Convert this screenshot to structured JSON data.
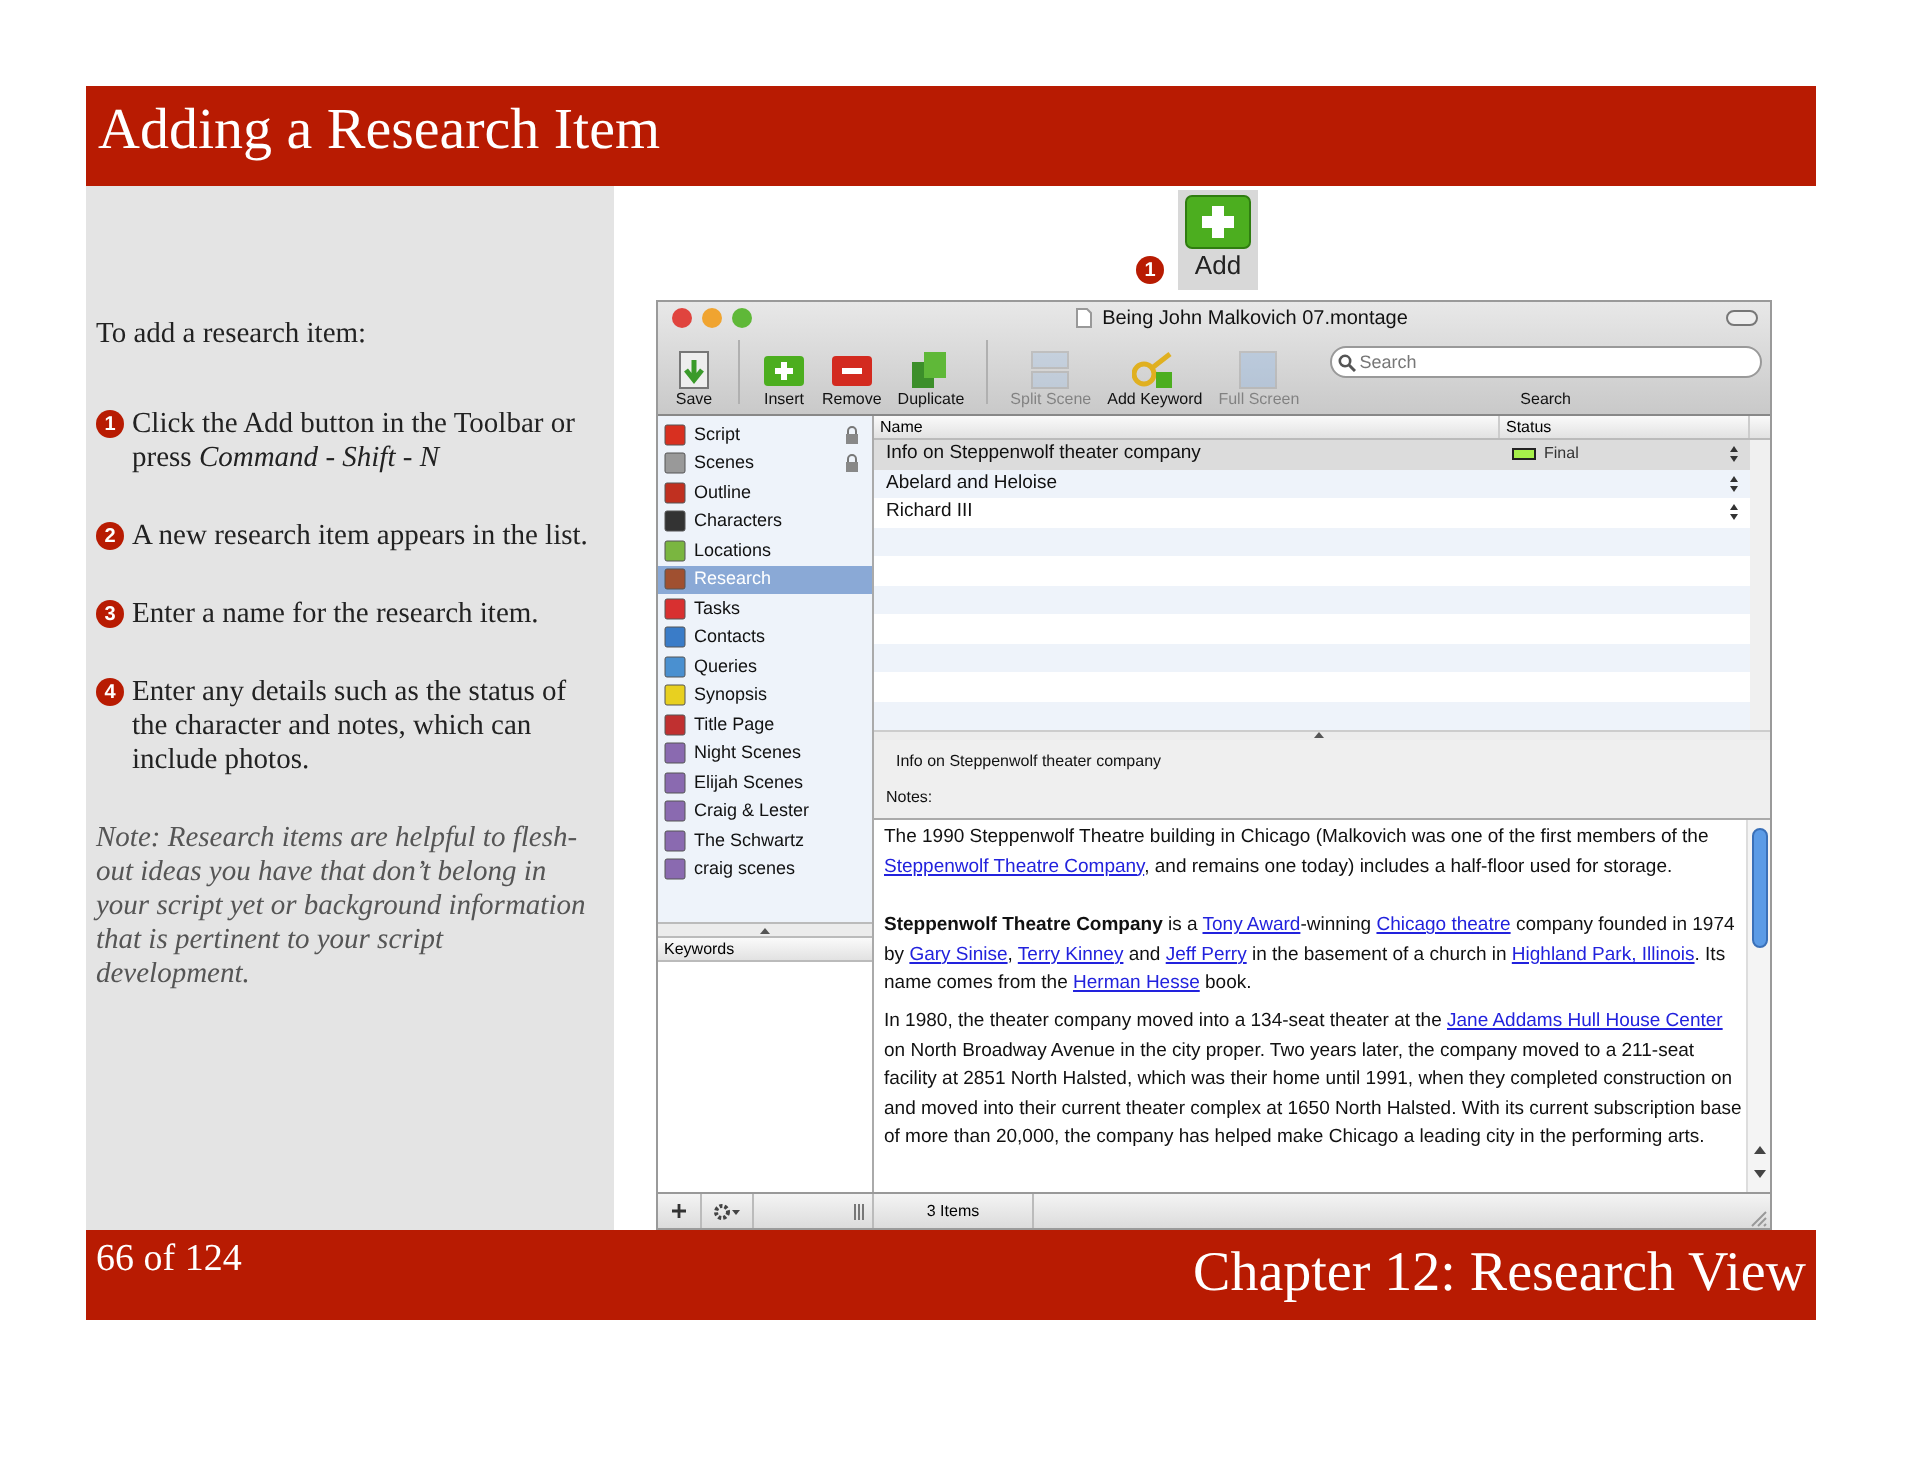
{
  "header": {
    "title": "Adding a Research Item"
  },
  "instructions": {
    "intro": "To add a research item:",
    "steps": [
      {
        "number": "1",
        "text": "Click the Add button in the Toolbar or press *Command* - *Shift* - *N*"
      },
      {
        "number": "2",
        "text": "A new research item appears in the list."
      },
      {
        "number": "3",
        "text": "Enter a name for the research item."
      },
      {
        "number": "4",
        "text": "Enter any details such as the status of the character and notes, which can include photos."
      }
    ],
    "note": "Note: Research items are helpful to flesh-out ideas you have that don’t belong in your script yet or background information that is pertinent to your script development."
  },
  "callout": {
    "number": "1",
    "button_label": "Add"
  },
  "window": {
    "title": "Being John Malkovich 07.montage",
    "toolbar": [
      {
        "label": "Save",
        "disabled": false
      },
      {
        "label": "Insert",
        "disabled": false
      },
      {
        "label": "Remove",
        "disabled": false
      },
      {
        "label": "Duplicate",
        "disabled": false
      },
      {
        "label": "Split Scene",
        "disabled": true
      },
      {
        "label": "Add Keyword",
        "disabled": false
      },
      {
        "label": "Full Screen",
        "disabled": true
      }
    ],
    "search": {
      "placeholder": "Search",
      "label": "Search"
    },
    "sidebar": {
      "items": [
        {
          "label": "Script",
          "locked": true,
          "selected": false
        },
        {
          "label": "Scenes",
          "locked": true,
          "selected": false
        },
        {
          "label": "Outline",
          "locked": false,
          "selected": false
        },
        {
          "label": "Characters",
          "locked": false,
          "selected": false
        },
        {
          "label": "Locations",
          "locked": false,
          "selected": false
        },
        {
          "label": "Research",
          "locked": false,
          "selected": true
        },
        {
          "label": "Tasks",
          "locked": false,
          "selected": false
        },
        {
          "label": "Contacts",
          "locked": false,
          "selected": false
        },
        {
          "label": "Queries",
          "locked": false,
          "selected": false
        },
        {
          "label": "Synopsis",
          "locked": false,
          "selected": false
        },
        {
          "label": "Title Page",
          "locked": false,
          "selected": false
        },
        {
          "label": "Night Scenes",
          "locked": false,
          "selected": false
        },
        {
          "label": "Elijah Scenes",
          "locked": false,
          "selected": false
        },
        {
          "label": "Craig & Lester",
          "locked": false,
          "selected": false
        },
        {
          "label": "The Schwartz",
          "locked": false,
          "selected": false
        },
        {
          "label": "craig scenes",
          "locked": false,
          "selected": false
        }
      ],
      "keywords_header": "Keywords"
    },
    "table": {
      "columns": [
        "Name",
        "Status"
      ],
      "rows": [
        {
          "name": "Info on Steppenwolf theater company",
          "status": {
            "label": "Final",
            "color": "#a6f04a"
          },
          "selected": true
        },
        {
          "name": "Abelard and Heloise",
          "selected": false
        },
        {
          "name": "Richard III",
          "selected": false
        }
      ]
    },
    "detail": {
      "name": "Info on Steppenwolf theater company",
      "notes_label": "Notes:"
    },
    "notes": [
      [
        {
          "kind": "plain",
          "text": "The 1990 Steppenwolf Theatre building in Chicago (Malkovich was one of the first members of the "
        },
        {
          "kind": "link",
          "text": "Steppenwolf Theatre Company"
        },
        {
          "kind": "plain",
          "text": ", and remains one today) includes a half-floor used for storage."
        }
      ],
      [
        {
          "kind": "bold",
          "text": "Steppenwolf Theatre Company"
        },
        {
          "kind": "plain",
          "text": " is a "
        },
        {
          "kind": "link",
          "text": "Tony Award"
        },
        {
          "kind": "plain",
          "text": "-winning "
        },
        {
          "kind": "link",
          "text": "Chicago theatre"
        },
        {
          "kind": "plain",
          "text": " company founded in 1974 by "
        },
        {
          "kind": "link",
          "text": "Gary Sinise"
        },
        {
          "kind": "plain",
          "text": ", "
        },
        {
          "kind": "link",
          "text": "Terry Kinney"
        },
        {
          "kind": "plain",
          "text": " and "
        },
        {
          "kind": "link",
          "text": "Jeff Perry"
        },
        {
          "kind": "plain",
          "text": " in the basement of a church in "
        },
        {
          "kind": "link",
          "text": "Highland Park, Illinois"
        },
        {
          "kind": "plain",
          "text": ". Its name comes from the "
        },
        {
          "kind": "link",
          "text": "Herman Hesse"
        },
        {
          "kind": "plain",
          "text": " book."
        }
      ],
      [
        {
          "kind": "plain",
          "text": "In 1980, the theater company moved into a 134-seat theater at the "
        },
        {
          "kind": "link",
          "text": "Jane Addams Hull House Center"
        },
        {
          "kind": "plain",
          "text": " on North Broadway Avenue in the city proper. Two years later, the company moved to a 211-seat facility at 2851 North Halsted, which was their home until 1991, when they completed construction on and moved into their current theater complex at 1650 North Halsted. With its current subscription base of more than 20,000, the company has helped make Chicago a leading city in the performing arts."
        }
      ]
    ],
    "status_bar": {
      "count": "3 Items"
    }
  },
  "footer": {
    "page": "66 of 124",
    "chapter": "Chapter 12: Research View"
  }
}
